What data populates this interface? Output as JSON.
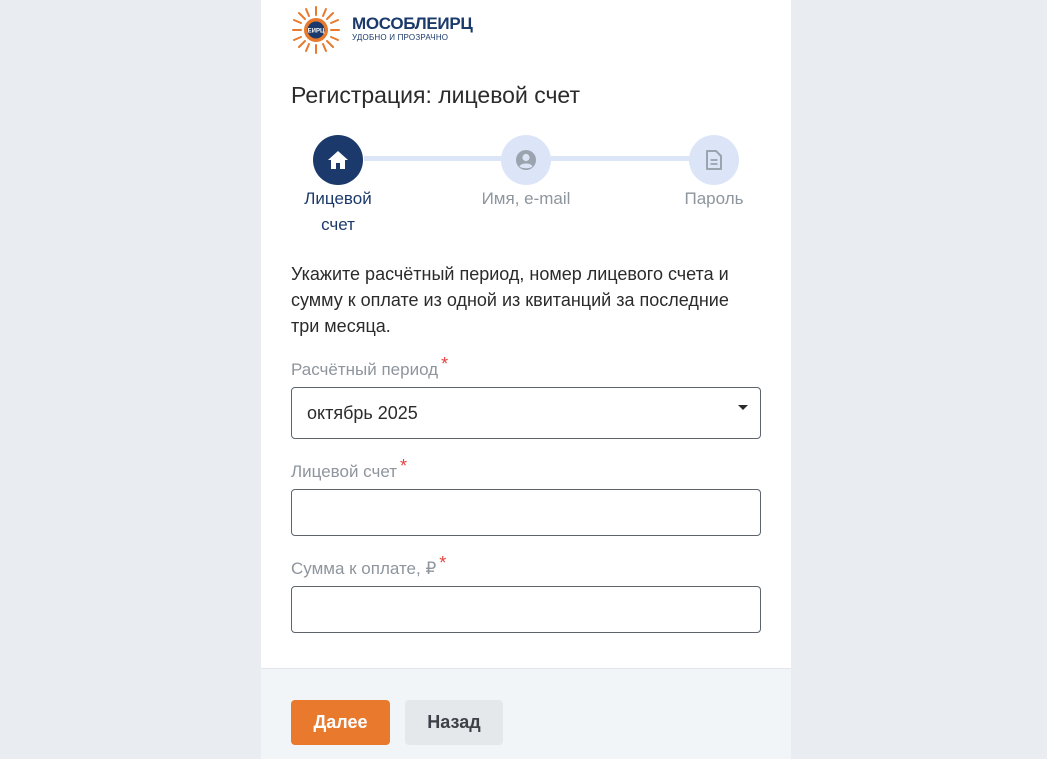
{
  "brand": {
    "name": "МОСОБЛЕИРЦ",
    "tagline": "УДОБНО И ПРОЗРАЧНО",
    "badge": "ЕИРЦ"
  },
  "page": {
    "title": "Регистрация: лицевой счет"
  },
  "steps": [
    {
      "label_line1": "Лицевой",
      "label_line2": "счет",
      "icon": "home-icon",
      "state": "active"
    },
    {
      "label_line1": "Имя, e-mail",
      "label_line2": "",
      "icon": "user-icon",
      "state": "pending"
    },
    {
      "label_line1": "Пароль",
      "label_line2": "",
      "icon": "document-icon",
      "state": "pending"
    }
  ],
  "instructions": "Укажите расчётный период, номер лицевого счета и сумму к оплате из одной из квитанций за последние три месяца.",
  "form": {
    "period": {
      "label": "Расчётный период",
      "required_mark": "*",
      "value": "октябрь 2025"
    },
    "account": {
      "label": "Лицевой счет",
      "required_mark": "*",
      "value": "",
      "placeholder": ""
    },
    "amount": {
      "label": "Сумма к оплате, ₽",
      "required_mark": "*",
      "value": "",
      "placeholder": ""
    }
  },
  "buttons": {
    "next": "Далее",
    "back": "Назад"
  },
  "colors": {
    "page_bg": "#e9edf1",
    "primary": "#1b3a6b",
    "accent": "#e8792d",
    "step_pending": "#dbe5f7",
    "required": "#e8413c"
  }
}
